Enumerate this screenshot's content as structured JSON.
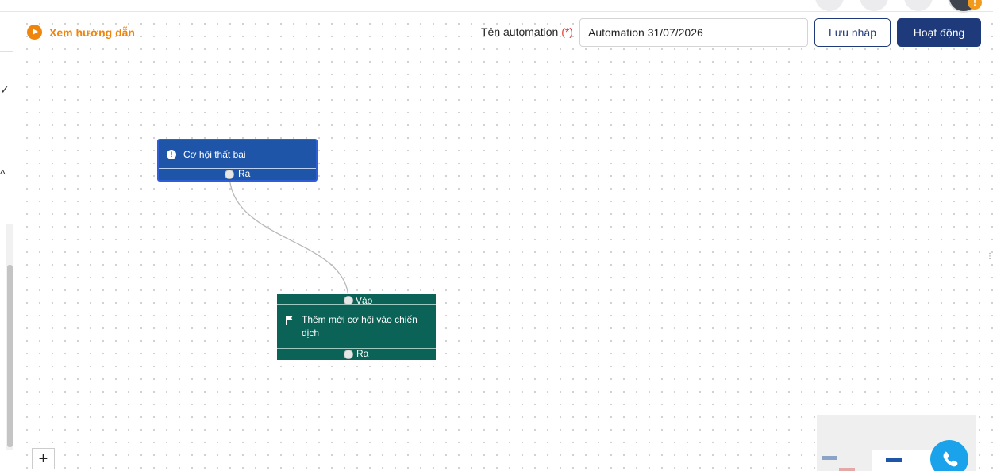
{
  "header": {
    "guide_link": "Xem hướng dẫn",
    "name_label": "Tên automation",
    "required_mark": "(*)",
    "name_value": "Automation 31/07/2026",
    "save_draft": "Lưu nháp",
    "activate": "Hoạt động"
  },
  "nodes": {
    "trigger": {
      "title": "Cơ hội thất bại",
      "out_label": "Ra",
      "color": "#1e55a8"
    },
    "action": {
      "in_label": "Vào",
      "title": "Thêm mới cơ hội vào chiến dịch",
      "out_label": "Ra",
      "color": "#0a6356"
    }
  },
  "canvas": {
    "zoom_in": "+"
  },
  "icons": {
    "guide": "play-circle-icon",
    "trigger": "alert-circle-icon",
    "action": "flag-icon",
    "call": "phone-icon"
  },
  "colors": {
    "accent": "#f0850c",
    "primary": "#1f3a7a",
    "call": "#1aa3ea"
  }
}
